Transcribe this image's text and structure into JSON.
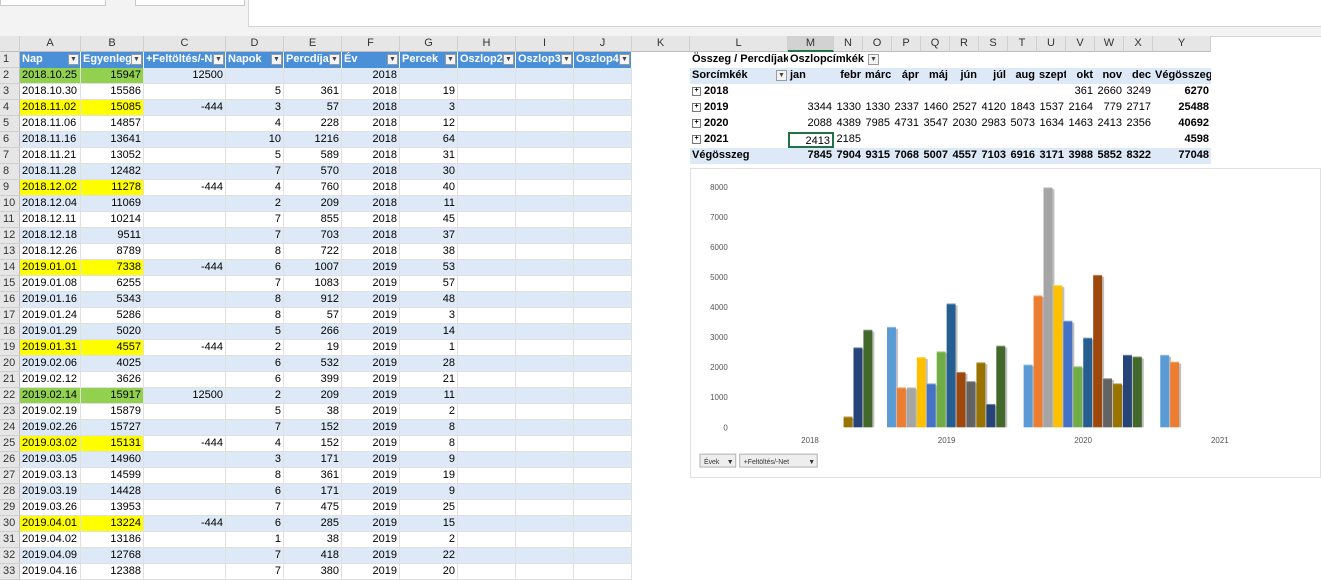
{
  "columns": [
    "A",
    "B",
    "C",
    "D",
    "E",
    "F",
    "G",
    "H",
    "I",
    "J",
    "K",
    "L",
    "M",
    "N",
    "O",
    "P",
    "Q",
    "R",
    "S",
    "T",
    "U",
    "V",
    "W",
    "X",
    "Y"
  ],
  "table_headers": [
    "Nap",
    "Egyenleg",
    "+Feltöltés/-Net",
    "Napok",
    "Percdíjak",
    "Év",
    "Percek",
    "Oszlop2",
    "Oszlop3",
    "Oszlop4"
  ],
  "rows": [
    {
      "n": "2",
      "a": "2018.10.25",
      "b": "15947",
      "c": "12500",
      "d": "",
      "e": "",
      "f": "2018",
      "g": "",
      "hl": "green"
    },
    {
      "n": "3",
      "a": "2018.10.30",
      "b": "15586",
      "c": "",
      "d": "5",
      "e": "361",
      "f": "2018",
      "g": "19",
      "hl": ""
    },
    {
      "n": "4",
      "a": "2018.11.02",
      "b": "15085",
      "c": "-444",
      "d": "3",
      "e": "57",
      "f": "2018",
      "g": "3",
      "hl": "yellow"
    },
    {
      "n": "5",
      "a": "2018.11.06",
      "b": "14857",
      "c": "",
      "d": "4",
      "e": "228",
      "f": "2018",
      "g": "12",
      "hl": ""
    },
    {
      "n": "6",
      "a": "2018.11.16",
      "b": "13641",
      "c": "",
      "d": "10",
      "e": "1216",
      "f": "2018",
      "g": "64",
      "hl": ""
    },
    {
      "n": "7",
      "a": "2018.11.21",
      "b": "13052",
      "c": "",
      "d": "5",
      "e": "589",
      "f": "2018",
      "g": "31",
      "hl": ""
    },
    {
      "n": "8",
      "a": "2018.11.28",
      "b": "12482",
      "c": "",
      "d": "7",
      "e": "570",
      "f": "2018",
      "g": "30",
      "hl": ""
    },
    {
      "n": "9",
      "a": "2018.12.02",
      "b": "11278",
      "c": "-444",
      "d": "4",
      "e": "760",
      "f": "2018",
      "g": "40",
      "hl": "yellow"
    },
    {
      "n": "10",
      "a": "2018.12.04",
      "b": "11069",
      "c": "",
      "d": "2",
      "e": "209",
      "f": "2018",
      "g": "11",
      "hl": ""
    },
    {
      "n": "11",
      "a": "2018.12.11",
      "b": "10214",
      "c": "",
      "d": "7",
      "e": "855",
      "f": "2018",
      "g": "45",
      "hl": ""
    },
    {
      "n": "12",
      "a": "2018.12.18",
      "b": "9511",
      "c": "",
      "d": "7",
      "e": "703",
      "f": "2018",
      "g": "37",
      "hl": ""
    },
    {
      "n": "13",
      "a": "2018.12.26",
      "b": "8789",
      "c": "",
      "d": "8",
      "e": "722",
      "f": "2018",
      "g": "38",
      "hl": ""
    },
    {
      "n": "14",
      "a": "2019.01.01",
      "b": "7338",
      "c": "-444",
      "d": "6",
      "e": "1007",
      "f": "2019",
      "g": "53",
      "hl": "yellow"
    },
    {
      "n": "15",
      "a": "2019.01.08",
      "b": "6255",
      "c": "",
      "d": "7",
      "e": "1083",
      "f": "2019",
      "g": "57",
      "hl": ""
    },
    {
      "n": "16",
      "a": "2019.01.16",
      "b": "5343",
      "c": "",
      "d": "8",
      "e": "912",
      "f": "2019",
      "g": "48",
      "hl": ""
    },
    {
      "n": "17",
      "a": "2019.01.24",
      "b": "5286",
      "c": "",
      "d": "8",
      "e": "57",
      "f": "2019",
      "g": "3",
      "hl": ""
    },
    {
      "n": "18",
      "a": "2019.01.29",
      "b": "5020",
      "c": "",
      "d": "5",
      "e": "266",
      "f": "2019",
      "g": "14",
      "hl": ""
    },
    {
      "n": "19",
      "a": "2019.01.31",
      "b": "4557",
      "c": "-444",
      "d": "2",
      "e": "19",
      "f": "2019",
      "g": "1",
      "hl": "yellow"
    },
    {
      "n": "20",
      "a": "2019.02.06",
      "b": "4025",
      "c": "",
      "d": "6",
      "e": "532",
      "f": "2019",
      "g": "28",
      "hl": ""
    },
    {
      "n": "21",
      "a": "2019.02.12",
      "b": "3626",
      "c": "",
      "d": "6",
      "e": "399",
      "f": "2019",
      "g": "21",
      "hl": ""
    },
    {
      "n": "22",
      "a": "2019.02.14",
      "b": "15917",
      "c": "12500",
      "d": "2",
      "e": "209",
      "f": "2019",
      "g": "11",
      "hl": "green"
    },
    {
      "n": "23",
      "a": "2019.02.19",
      "b": "15879",
      "c": "",
      "d": "5",
      "e": "38",
      "f": "2019",
      "g": "2",
      "hl": ""
    },
    {
      "n": "24",
      "a": "2019.02.26",
      "b": "15727",
      "c": "",
      "d": "7",
      "e": "152",
      "f": "2019",
      "g": "8",
      "hl": ""
    },
    {
      "n": "25",
      "a": "2019.03.02",
      "b": "15131",
      "c": "-444",
      "d": "4",
      "e": "152",
      "f": "2019",
      "g": "8",
      "hl": "yellow"
    },
    {
      "n": "26",
      "a": "2019.03.05",
      "b": "14960",
      "c": "",
      "d": "3",
      "e": "171",
      "f": "2019",
      "g": "9",
      "hl": ""
    },
    {
      "n": "27",
      "a": "2019.03.13",
      "b": "14599",
      "c": "",
      "d": "8",
      "e": "361",
      "f": "2019",
      "g": "19",
      "hl": ""
    },
    {
      "n": "28",
      "a": "2019.03.19",
      "b": "14428",
      "c": "",
      "d": "6",
      "e": "171",
      "f": "2019",
      "g": "9",
      "hl": ""
    },
    {
      "n": "29",
      "a": "2019.03.26",
      "b": "13953",
      "c": "",
      "d": "7",
      "e": "475",
      "f": "2019",
      "g": "25",
      "hl": ""
    },
    {
      "n": "30",
      "a": "2019.04.01",
      "b": "13224",
      "c": "-444",
      "d": "6",
      "e": "285",
      "f": "2019",
      "g": "15",
      "hl": "yellow"
    },
    {
      "n": "31",
      "a": "2019.04.02",
      "b": "13186",
      "c": "",
      "d": "1",
      "e": "38",
      "f": "2019",
      "g": "2",
      "hl": ""
    },
    {
      "n": "32",
      "a": "2019.04.09",
      "b": "12768",
      "c": "",
      "d": "7",
      "e": "418",
      "f": "2019",
      "g": "22",
      "hl": ""
    },
    {
      "n": "33",
      "a": "2019.04.16",
      "b": "12388",
      "c": "",
      "d": "7",
      "e": "380",
      "f": "2019",
      "g": "20",
      "hl": ""
    }
  ],
  "pivot": {
    "corner": "Összeg / Percdíjak",
    "col_label": "Oszlopcímkék",
    "row_label": "Sorcímkék",
    "months": [
      "jan",
      "febr",
      "márc",
      "ápr",
      "máj",
      "jún",
      "júl",
      "aug",
      "szept",
      "okt",
      "nov",
      "dec",
      "Végösszeg"
    ],
    "rows": [
      {
        "label": "2018",
        "cells": [
          "",
          "",
          "",
          "",
          "",
          "",
          "",
          "",
          "",
          "361",
          "2660",
          "3249",
          "6270"
        ]
      },
      {
        "label": "2019",
        "cells": [
          "3344",
          "1330",
          "1330",
          "2337",
          "1460",
          "2527",
          "4120",
          "1843",
          "1537",
          "2164",
          "779",
          "2717",
          "25488"
        ]
      },
      {
        "label": "2020",
        "cells": [
          "2088",
          "4389",
          "7985",
          "4731",
          "3547",
          "2030",
          "2983",
          "5073",
          "1634",
          "1463",
          "2413",
          "2356",
          "40692"
        ]
      },
      {
        "label": "2021",
        "cells": [
          "2413",
          "2185",
          "",
          "",
          "",
          "",
          "",
          "",
          "",
          "",
          "",
          "",
          "4598"
        ]
      }
    ],
    "total": {
      "label": "Végösszeg",
      "cells": [
        "7845",
        "7904",
        "9315",
        "7068",
        "5007",
        "4557",
        "7103",
        "6916",
        "3171",
        "3988",
        "5852",
        "8322",
        "77048"
      ]
    }
  },
  "chart_buttons": [
    "Évek",
    "+Feltöltés/-Net"
  ],
  "chart_data": {
    "type": "bar",
    "categories": [
      "2018",
      "2019",
      "2020",
      "2021"
    ],
    "ylim": [
      0,
      8000
    ],
    "yticks": [
      0,
      1000,
      2000,
      3000,
      4000,
      5000,
      6000,
      7000,
      8000
    ],
    "grid": false,
    "legend": "none",
    "series": [
      {
        "color": "#5b9bd5",
        "values": [
          0,
          3344,
          2088,
          2413
        ]
      },
      {
        "color": "#ed7d31",
        "values": [
          0,
          1330,
          4389,
          2185
        ]
      },
      {
        "color": "#a5a5a5",
        "values": [
          0,
          1330,
          7985,
          0
        ]
      },
      {
        "color": "#ffc000",
        "values": [
          0,
          2337,
          4731,
          0
        ]
      },
      {
        "color": "#4472c4",
        "values": [
          0,
          1460,
          3547,
          0
        ]
      },
      {
        "color": "#70ad47",
        "values": [
          0,
          2527,
          2030,
          0
        ]
      },
      {
        "color": "#255e91",
        "values": [
          0,
          4120,
          2983,
          0
        ]
      },
      {
        "color": "#9e480e",
        "values": [
          0,
          1843,
          5073,
          0
        ]
      },
      {
        "color": "#636363",
        "values": [
          0,
          1537,
          1634,
          0
        ]
      },
      {
        "color": "#997300",
        "values": [
          361,
          2164,
          1463,
          0
        ]
      },
      {
        "color": "#264478",
        "values": [
          2660,
          779,
          2413,
          0
        ]
      },
      {
        "color": "#43682b",
        "values": [
          3249,
          2717,
          2356,
          0
        ]
      }
    ]
  }
}
